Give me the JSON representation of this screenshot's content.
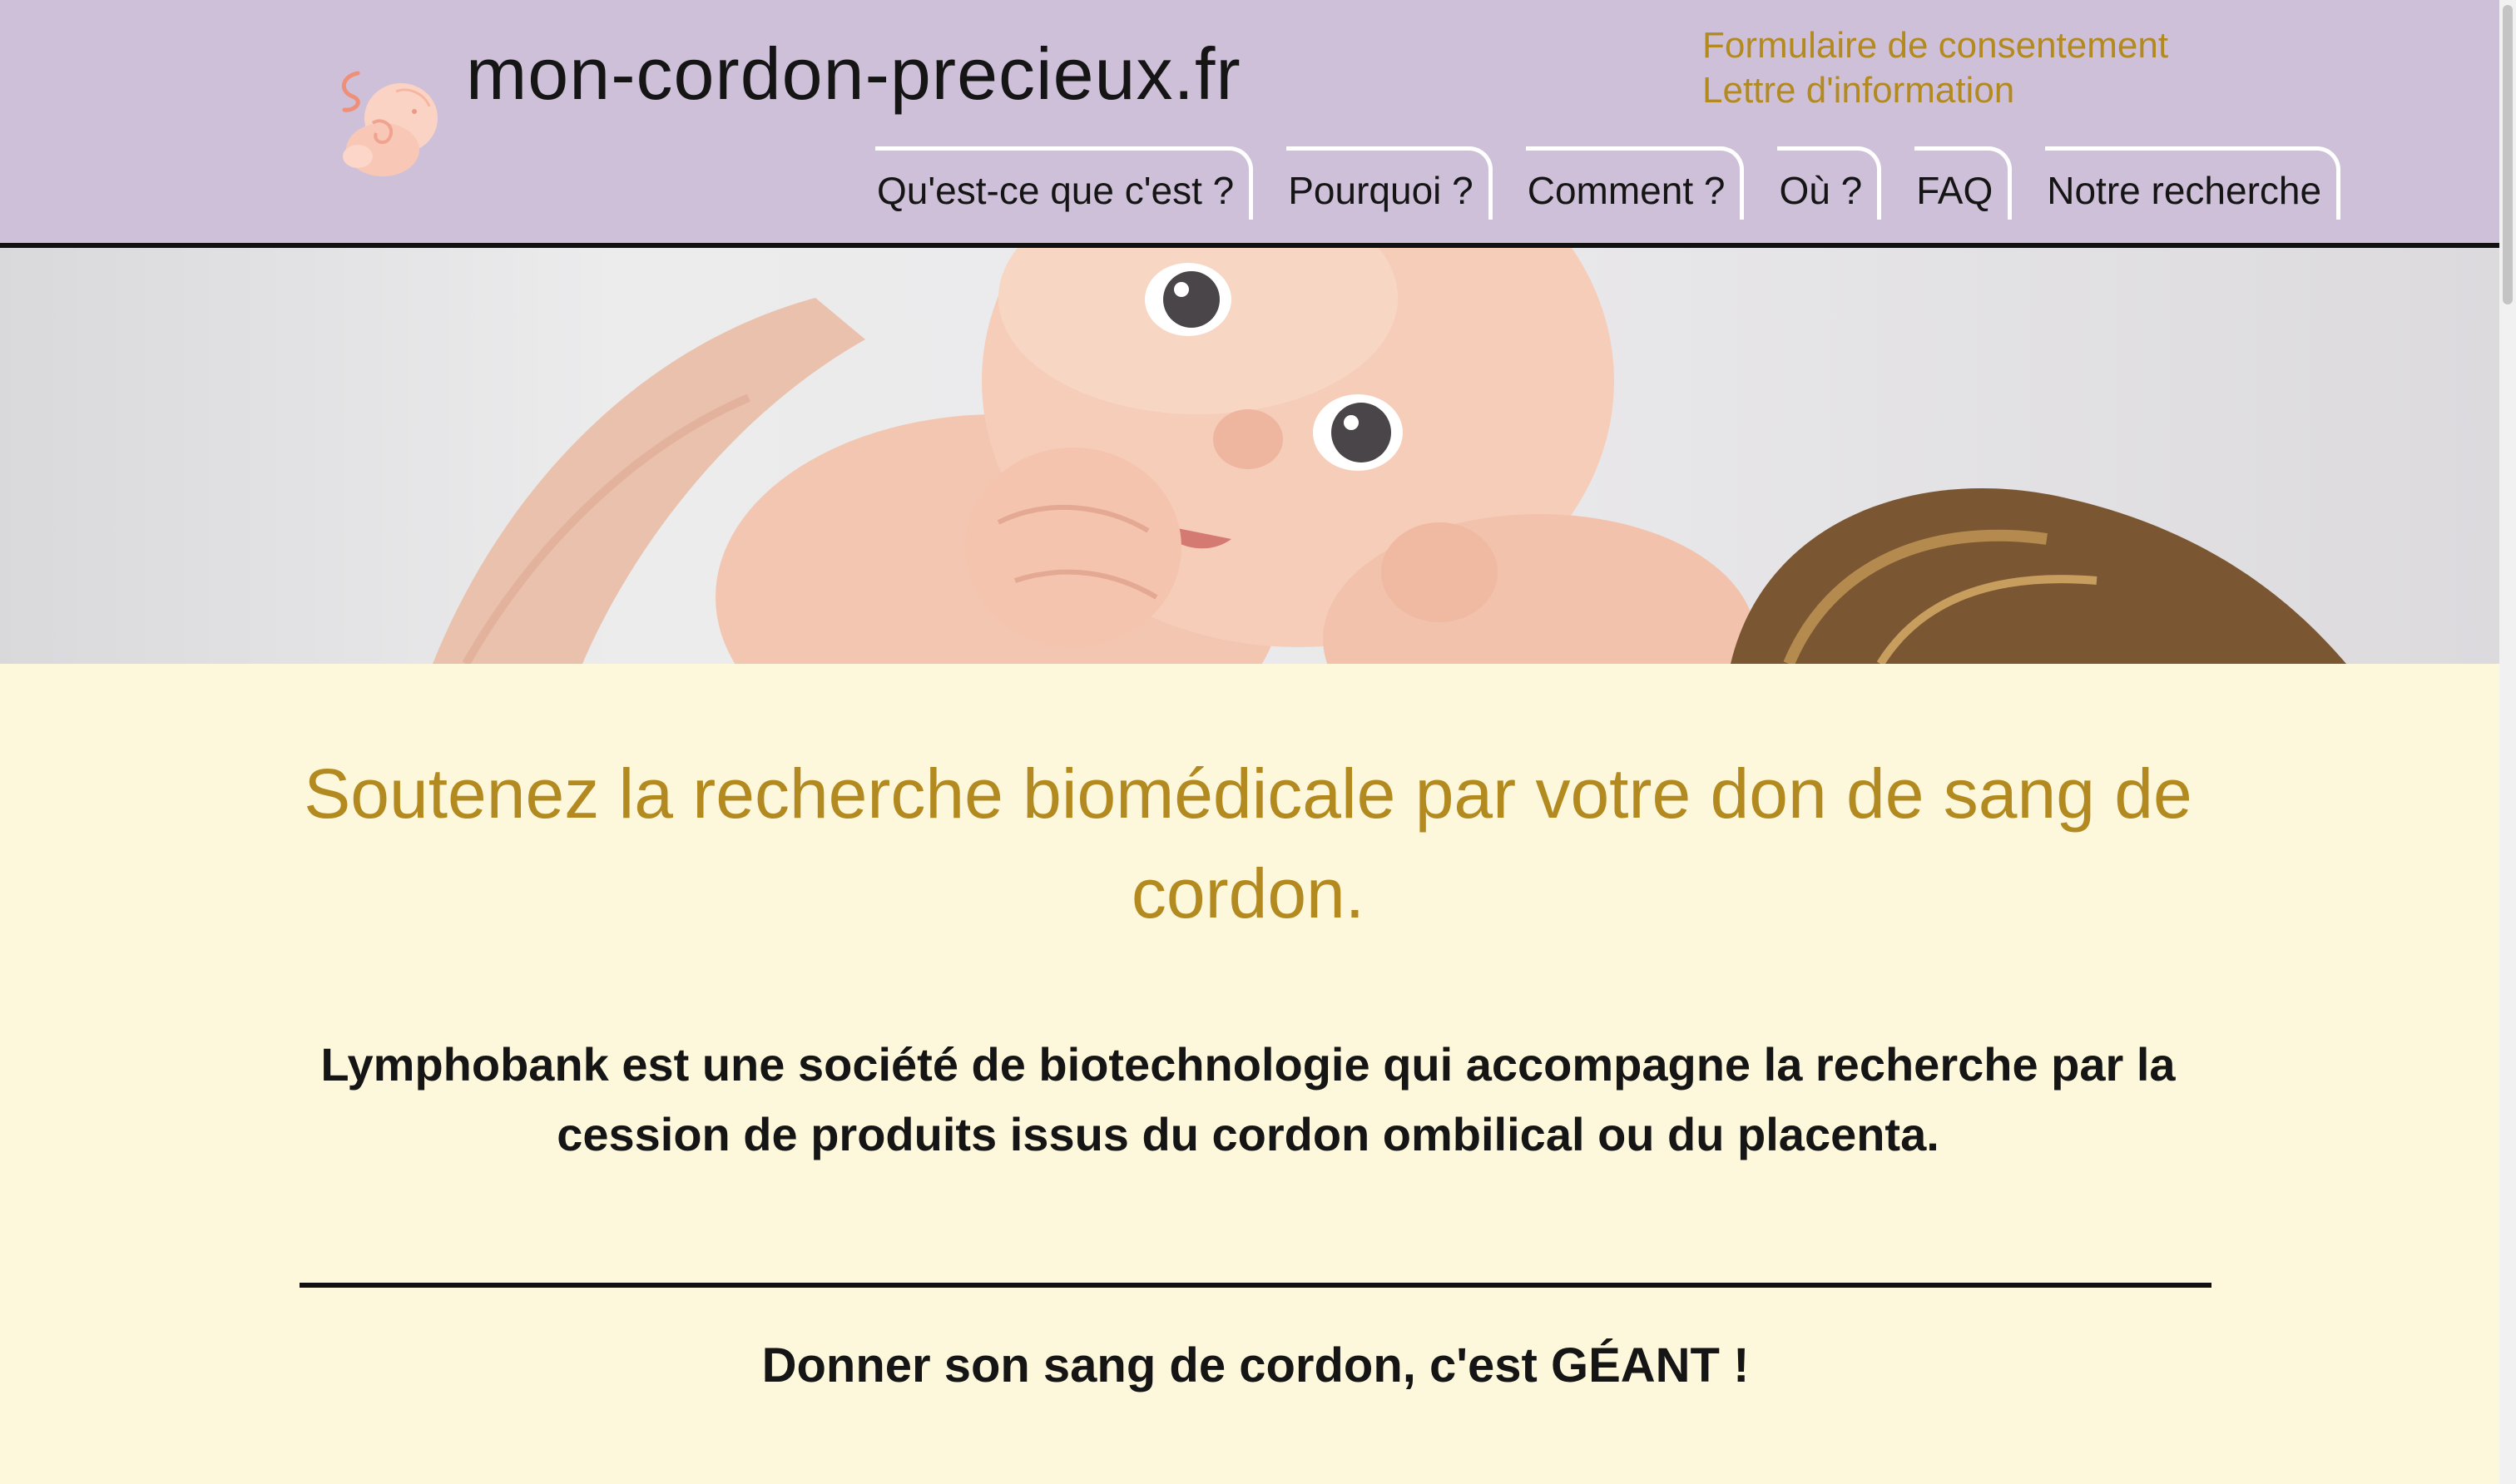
{
  "header": {
    "site_title": "mon-cordon-precieux.fr",
    "logo_icon": "baby-embryo-icon",
    "top_links": [
      {
        "label": "Formulaire de consentement"
      },
      {
        "label": "Lettre d'information"
      }
    ],
    "nav": [
      {
        "label": "Qu'est-ce que c'est ?"
      },
      {
        "label": "Pourquoi ?"
      },
      {
        "label": "Comment ?"
      },
      {
        "label": "Où ?"
      },
      {
        "label": "FAQ"
      },
      {
        "label": "Notre recherche"
      }
    ]
  },
  "main": {
    "headline": "Soutenez la recherche biomédicale par votre don de sang de cordon.",
    "intro": "Lymphobank est une société de biotechnologie qui accompagne la recherche par la cession de produits issus du cordon ombilical ou du placenta.",
    "tagline": "Donner son sang de cordon, c'est GÉANT !"
  },
  "colors": {
    "header_bg": "#cfc0d9",
    "accent_gold": "#b38a1f",
    "page_bg": "#fdf7dc",
    "text_dark": "#151515"
  }
}
